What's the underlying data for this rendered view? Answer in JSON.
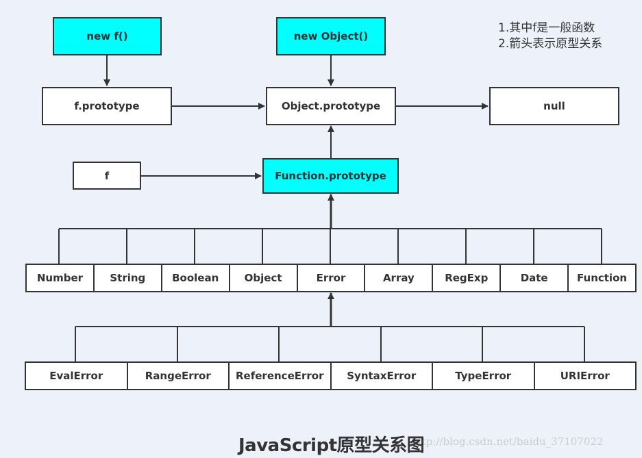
{
  "colors": {
    "highlight": "#00ffff",
    "box": "#ffffff",
    "stroke": "#333333",
    "background": "#edf1f9"
  },
  "nodes": {
    "new_f": "new f()",
    "new_object": "new Object()",
    "f_prototype": "f.prototype",
    "object_prototype": "Object.prototype",
    "null": "null",
    "f": "f",
    "function_prototype": "Function.prototype"
  },
  "builtins": [
    "Number",
    "String",
    "Boolean",
    "Object",
    "Error",
    "Array",
    "RegExp",
    "Date",
    "Function"
  ],
  "errors": [
    "EvalError",
    "RangeError",
    "ReferenceError",
    "SyntaxError",
    "TypeError",
    "URIError"
  ],
  "notes": [
    "1.其中f是一般函数",
    "2.箭头表示原型关系"
  ],
  "title": "JavaScript原型关系图",
  "watermark": "http://blog.csdn.net/baidu_37107022"
}
